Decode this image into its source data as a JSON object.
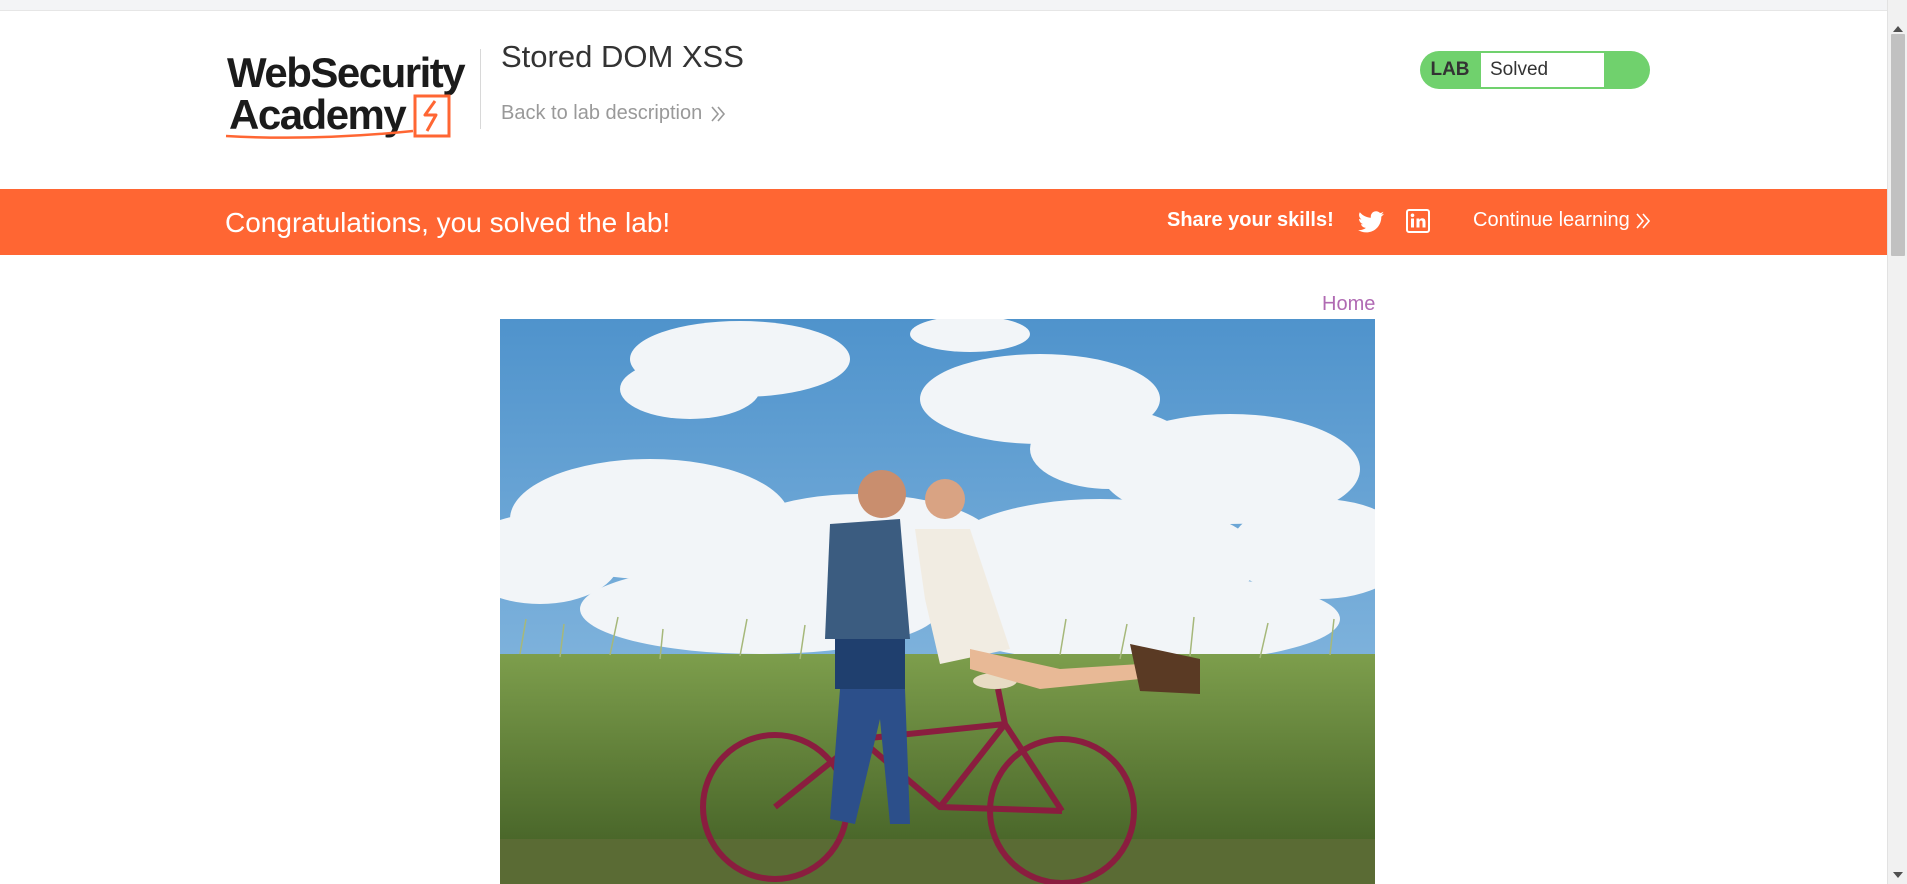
{
  "header": {
    "logo_line1": "WebSecurity",
    "logo_line2": "Academy",
    "lab_title": "Stored DOM XSS",
    "back_link": "Back to lab description"
  },
  "lab_status": {
    "tag": "LAB",
    "value": "Solved",
    "color": "#70d16d"
  },
  "banner": {
    "message": "Congratulations, you solved the lab!",
    "share_label": "Share your skills!",
    "share_icons": [
      "twitter-icon",
      "linkedin-icon"
    ],
    "continue_label": "Continue learning",
    "color": "#ff6633"
  },
  "nav": {
    "home": "Home"
  },
  "colors": {
    "accent": "#ff6633",
    "link": "#b06ab3"
  }
}
